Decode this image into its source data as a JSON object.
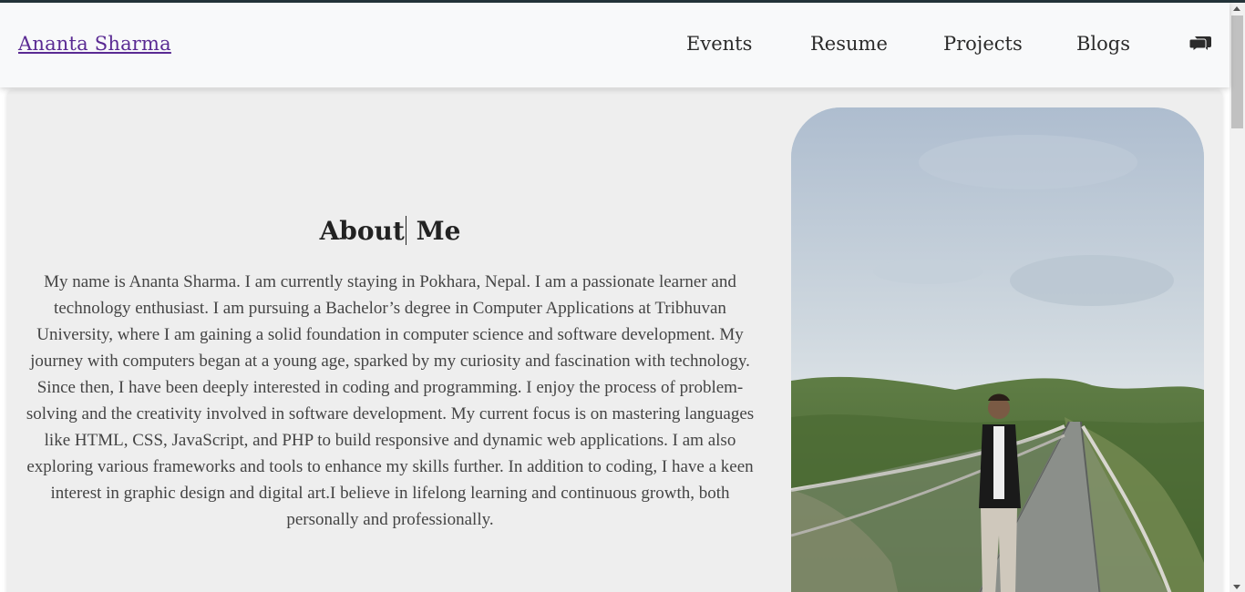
{
  "header": {
    "brand": "Ananta Sharma",
    "nav": [
      "Events",
      "Resume",
      "Projects",
      "Blogs"
    ],
    "chat_icon": "chat-bubbles-icon"
  },
  "about": {
    "title_part1": "About",
    "title_part2": "Me",
    "text": "My name is Ananta Sharma. I am currently staying in Pokhara, Nepal. I am a passionate learner and technology enthusiast. I am pursuing a Bachelor’s degree in Computer Applications at Tribhuvan University, where I am gaining a solid foundation in computer science and software development. My journey with computers began at a young age, sparked by my curiosity and fascination with technology. Since then, I have been deeply interested in coding and programming. I enjoy the process of problem-solving and the creativity involved in software development. My current focus is on mastering languages like HTML, CSS, JavaScript, and PHP to build responsive and dynamic web applications. I am also exploring various frameworks and tools to enhance my skills further. In addition to coding, I have a keen interest in graphic design and digital art.I believe in lifelong learning and continuous growth, both personally and professionally."
  },
  "colors": {
    "brand_link": "#5a2a93",
    "top_border": "#24343a",
    "card_bg": "#eeeeee"
  }
}
